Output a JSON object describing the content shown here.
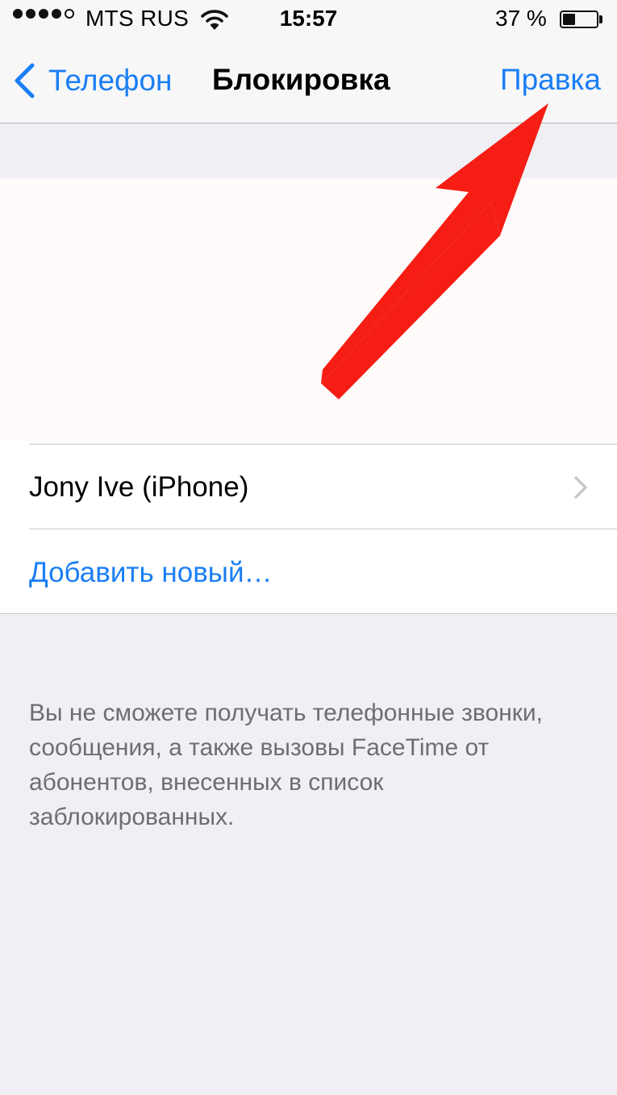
{
  "status_bar": {
    "carrier": "MTS RUS",
    "time": "15:57",
    "battery_percent": "37 %",
    "battery_level": 0.37,
    "signal_icon": "signal-dots-icon",
    "wifi_icon": "wifi-icon",
    "battery_icon": "battery-icon"
  },
  "nav": {
    "back_label": "Телефон",
    "back_icon": "chevron-left-icon",
    "title": "Блокировка",
    "edit_label": "Правка"
  },
  "blocked_list": {
    "contacts": [
      {
        "name": "Jony Ive (iPhone)",
        "icon": "chevron-right-icon"
      }
    ],
    "add_label": "Добавить новый…"
  },
  "footer": {
    "note": "Вы не сможете получать телефонные звонки, сообщения, а также вызовы FaceTime от абонентов, внесенных в список заблокированных."
  },
  "annotation": {
    "icon": "red-arrow-icon",
    "color": "#f51d14"
  },
  "colors": {
    "accent": "#1a7ef5",
    "background": "#efeff4",
    "footer_text": "#6d6d72"
  }
}
